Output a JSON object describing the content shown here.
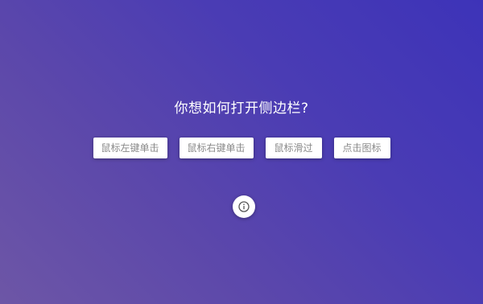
{
  "prompt": {
    "question": "你想如何打开侧边栏?"
  },
  "options": [
    {
      "label": "鼠标左键单击"
    },
    {
      "label": "鼠标右键单击"
    },
    {
      "label": "鼠标滑过"
    },
    {
      "label": "点击图标"
    }
  ],
  "info_button": {
    "icon": "info-icon"
  },
  "colors": {
    "gradient_start": "#6d56a6",
    "gradient_end": "#3d33b8",
    "button_bg": "#ffffff",
    "button_text": "#8a8a8a",
    "icon_color": "#555555"
  }
}
